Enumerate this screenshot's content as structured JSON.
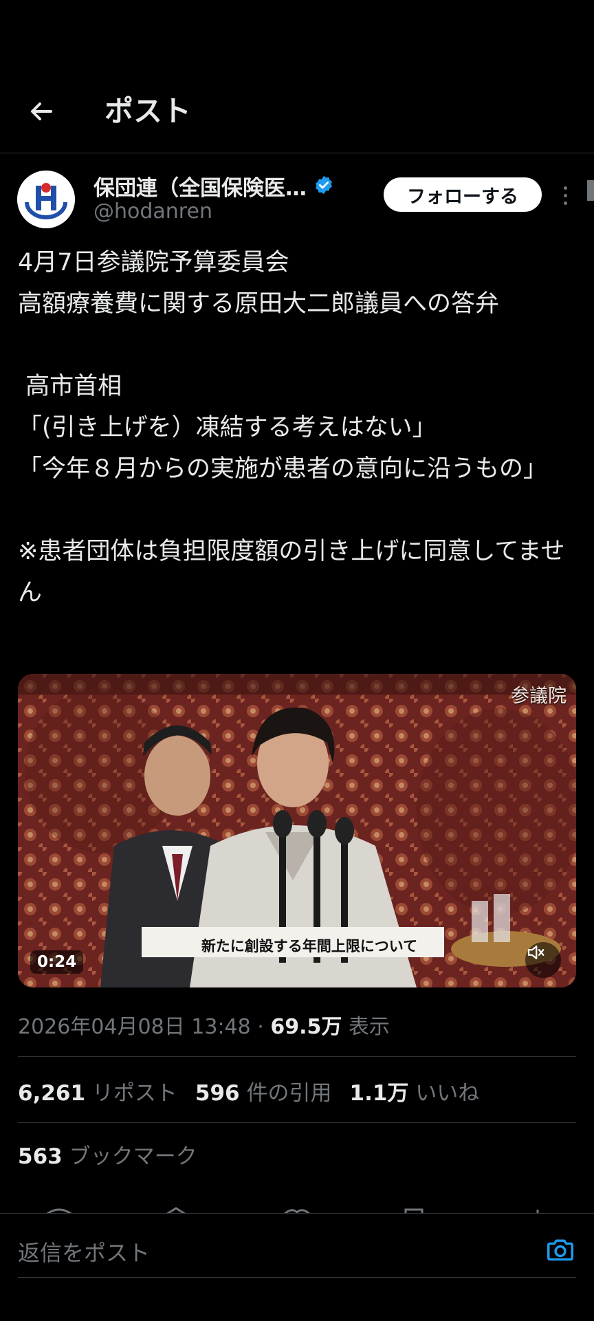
{
  "header": {
    "title": "ポスト",
    "back_icon": "back-arrow-icon"
  },
  "author": {
    "name": "保団連（全国保険医…",
    "handle": "@hodanren",
    "verified_icon": "verified-badge-icon",
    "follow_label": "フォローする"
  },
  "post": {
    "text": "4月7日参議院予算委員会\n高額療養費に関する原田大二郎議員への答弁\n\n 高市首相\n「(引き上げを）凍結する考えはない」\n「今年８月からの実施が患者の意向に沿うもの」\n\n※患者団体は負担限度額の引き上げに同意してません"
  },
  "media": {
    "watermark": "参議院",
    "caption": "新たに創設する年間上限について",
    "duration": "0:24",
    "mute_icon": "muted-speaker-icon"
  },
  "meta": {
    "date": "2026年04月08日 13:48",
    "separator": "·",
    "views_count": "69.5万",
    "views_label": "表示"
  },
  "stats": {
    "reposts_count": "6,261",
    "reposts_label": "リポスト",
    "quotes_count": "596",
    "quotes_label": "件の引用",
    "likes_count": "1.1万",
    "likes_label": "いいね",
    "bookmarks_count": "563",
    "bookmarks_label": "ブックマーク"
  },
  "reply": {
    "placeholder": "返信をポスト",
    "camera_icon": "camera-icon"
  },
  "colors": {
    "background": "#000000",
    "text": "#e7e9ea",
    "secondary": "#71767b",
    "accent": "#1d9bf0",
    "divider": "#2f3336"
  }
}
